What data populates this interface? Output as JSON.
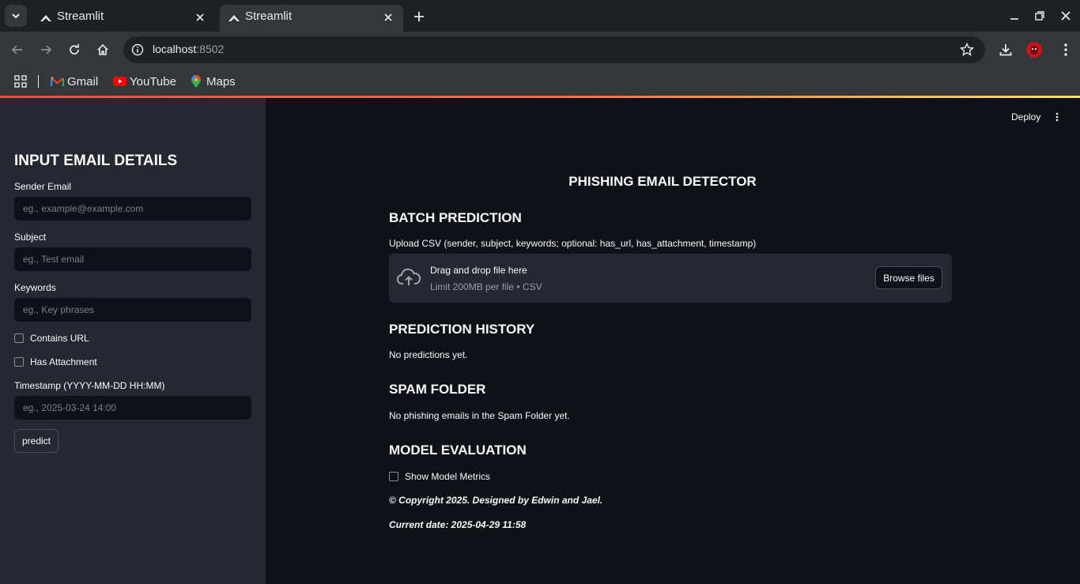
{
  "browser": {
    "tabs": [
      {
        "title": "Streamlit",
        "active": false
      },
      {
        "title": "Streamlit",
        "active": true
      }
    ],
    "url_host": "localhost",
    "url_port": ":8502",
    "bookmarks": [
      {
        "label": "Gmail",
        "icon": "gmail-icon"
      },
      {
        "label": "YouTube",
        "icon": "youtube-icon"
      },
      {
        "label": "Maps",
        "icon": "maps-icon"
      }
    ]
  },
  "header": {
    "deploy_label": "Deploy"
  },
  "sidebar": {
    "title": "INPUT EMAIL DETAILS",
    "sender_label": "Sender Email",
    "sender_placeholder": "eg., example@example.com",
    "subject_label": "Subject",
    "subject_placeholder": "eg., Test email",
    "keywords_label": "Keywords",
    "keywords_placeholder": "eg., Key phrases",
    "contains_url_label": "Contains URL",
    "has_attachment_label": "Has Attachment",
    "timestamp_label": "Timestamp (YYYY-MM-DD HH:MM)",
    "timestamp_placeholder": "eg., 2025-03-24 14:00",
    "predict_label": "predict"
  },
  "main": {
    "title": "PHISHING EMAIL DETECTOR",
    "batch_heading": "BATCH PREDICTION",
    "upload_label": "Upload CSV (sender, subject, keywords; optional: has_url, has_attachment, timestamp)",
    "drop_text": "Drag and drop file here",
    "limit_text": "Limit 200MB per file • CSV",
    "browse_label": "Browse files",
    "history_heading": "PREDICTION HISTORY",
    "history_text": "No predictions yet.",
    "spam_heading": "SPAM FOLDER",
    "spam_text": "No phishing emails in the Spam Folder yet.",
    "eval_heading": "MODEL EVALUATION",
    "show_metrics_label": "Show Model Metrics",
    "copyright": "© Copyright 2025. Designed by Edwin and Jael.",
    "current_date": "Current date: 2025-04-29 11:58"
  }
}
